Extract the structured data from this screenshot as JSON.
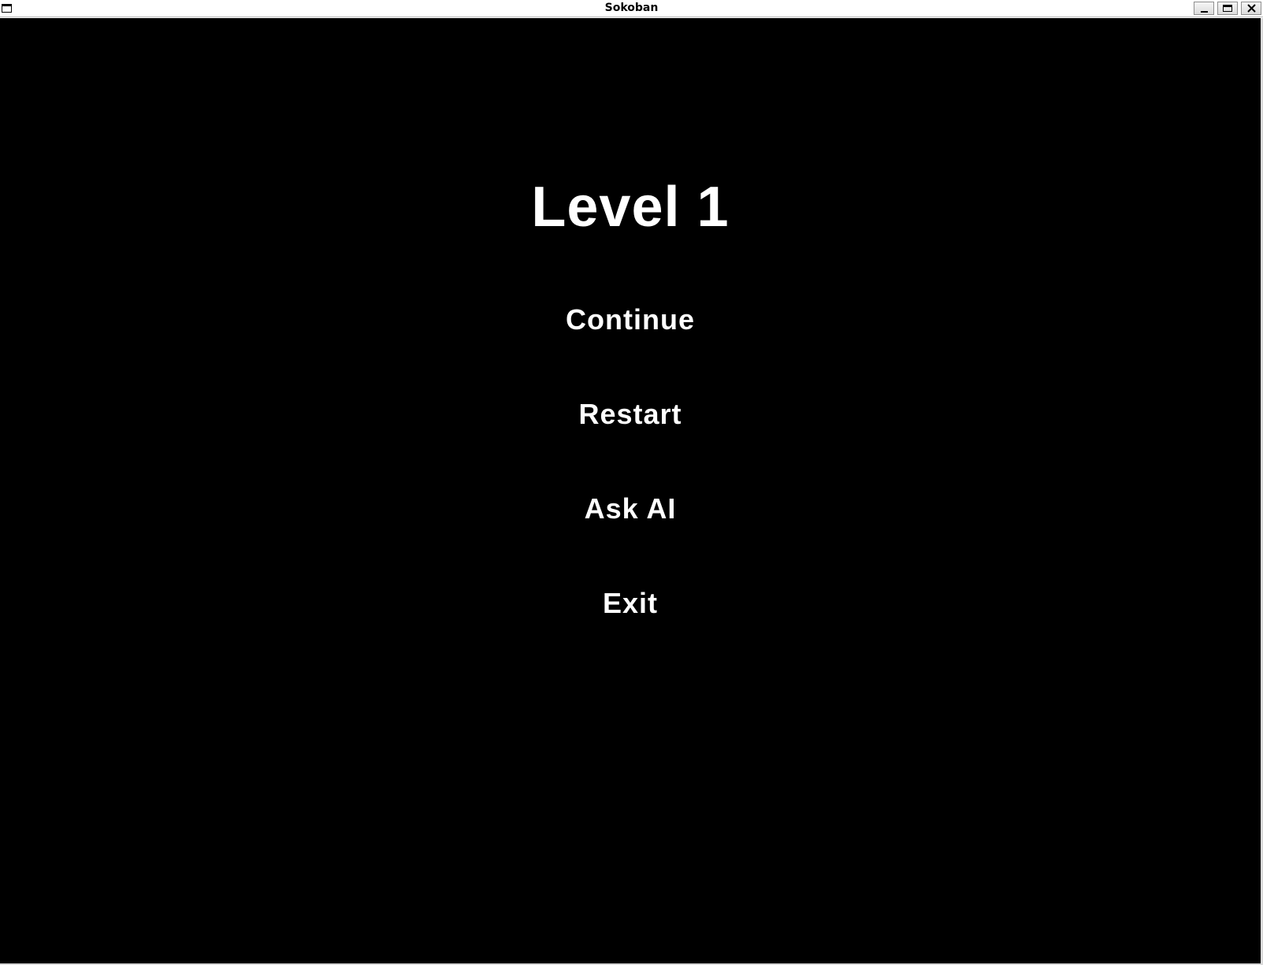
{
  "window": {
    "title": "Sokoban",
    "controls": {
      "minimize": "minimize-icon",
      "maximize": "maximize-icon",
      "close": "close-icon"
    }
  },
  "menu": {
    "heading": "Level 1",
    "items": [
      {
        "label": "Continue"
      },
      {
        "label": "Restart"
      },
      {
        "label": "Ask AI"
      },
      {
        "label": "Exit"
      }
    ]
  },
  "colors": {
    "background": "#000000",
    "text": "#ffffff",
    "titlebar": "#ffffff"
  }
}
